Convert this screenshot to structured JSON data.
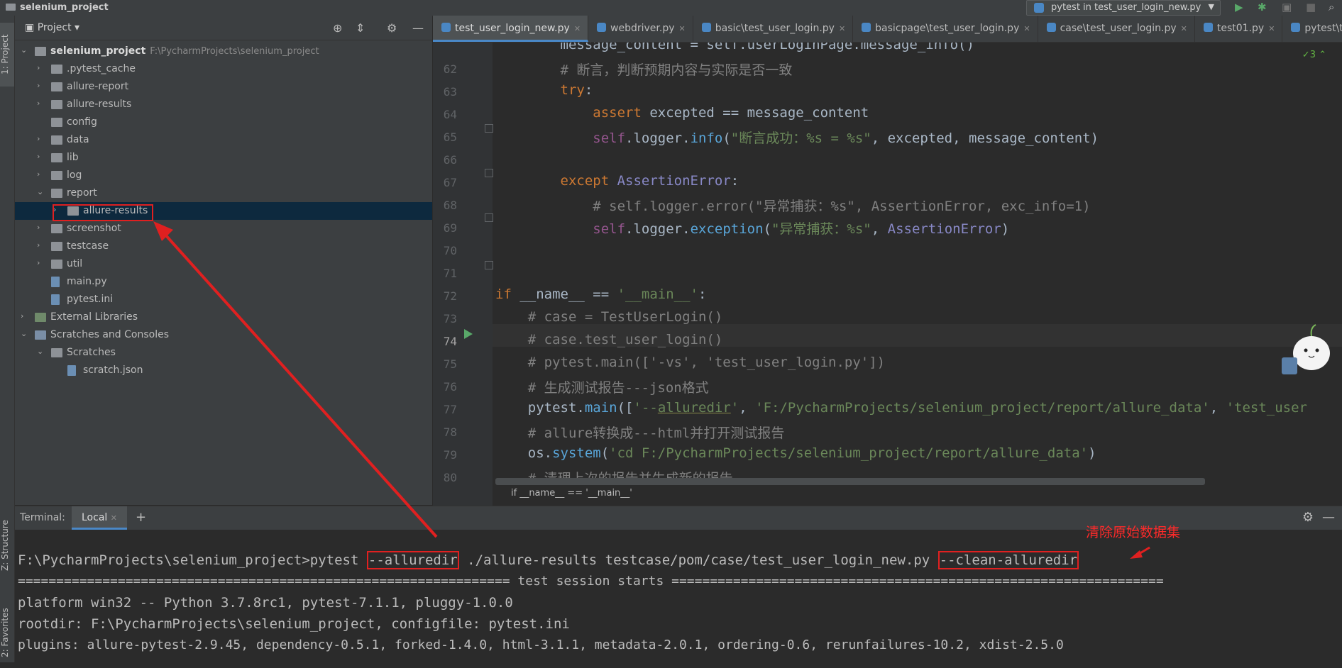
{
  "window": {
    "project_name": "selenium_project",
    "run_config": "pytest in test_user_login_new.py",
    "run_icon": "run-icon",
    "debug_icon": "debug-icon",
    "coverage_icon": "coverage-icon",
    "stop_icon": "stop-icon"
  },
  "side_tabs": {
    "project": "1: Project",
    "structure": "Z: Structure",
    "favorites": "2: Favorites"
  },
  "project_panel": {
    "title": "Project",
    "tree": [
      {
        "label": "selenium_project",
        "path": "F:\\PycharmProjects\\selenium_project",
        "depth": 0,
        "expanded": true,
        "type": "folder",
        "bold": true
      },
      {
        "label": ".pytest_cache",
        "depth": 1,
        "expanded": false,
        "type": "folder"
      },
      {
        "label": "allure-report",
        "depth": 1,
        "expanded": false,
        "type": "folder"
      },
      {
        "label": "allure-results",
        "depth": 1,
        "expanded": false,
        "type": "folder"
      },
      {
        "label": "config",
        "depth": 1,
        "type": "folder",
        "leaf": true
      },
      {
        "label": "data",
        "depth": 1,
        "expanded": false,
        "type": "folder"
      },
      {
        "label": "lib",
        "depth": 1,
        "expanded": false,
        "type": "folder"
      },
      {
        "label": "log",
        "depth": 1,
        "expanded": false,
        "type": "folder"
      },
      {
        "label": "report",
        "depth": 1,
        "expanded": true,
        "type": "folder"
      },
      {
        "label": "allure-results",
        "depth": 2,
        "expanded": false,
        "type": "folder",
        "selected": true
      },
      {
        "label": "screenshot",
        "depth": 1,
        "expanded": false,
        "type": "folder"
      },
      {
        "label": "testcase",
        "depth": 1,
        "expanded": false,
        "type": "folder"
      },
      {
        "label": "util",
        "depth": 1,
        "expanded": false,
        "type": "folder"
      },
      {
        "label": "main.py",
        "depth": 1,
        "type": "file",
        "leaf": true
      },
      {
        "label": "pytest.ini",
        "depth": 1,
        "type": "file",
        "leaf": true
      },
      {
        "label": "External Libraries",
        "depth": 0,
        "expanded": false,
        "type": "library"
      },
      {
        "label": "Scratches and Consoles",
        "depth": 0,
        "expanded": true,
        "type": "scratch"
      },
      {
        "label": "Scratches",
        "depth": 1,
        "expanded": true,
        "type": "folder"
      },
      {
        "label": "scratch.json",
        "depth": 2,
        "type": "file",
        "leaf": true
      }
    ]
  },
  "editor_tabs": [
    {
      "label": "test_user_login_new.py",
      "active": true,
      "closable": true
    },
    {
      "label": "webdriver.py",
      "closable": true
    },
    {
      "label": "basic\\test_user_login.py",
      "closable": true
    },
    {
      "label": "basicpage\\test_user_login.py",
      "closable": true
    },
    {
      "label": "case\\test_user_login.py",
      "closable": true
    },
    {
      "label": "test01.py",
      "closable": true
    },
    {
      "label": "pytest\\test_"
    }
  ],
  "editor": {
    "inspection_count": "3",
    "current_line": "74",
    "breadcrumb": "if __name__ == '__main__'",
    "partial_top_line": "        message_content = self.userLoginPage.message_info()",
    "line_numbers": [
      "62",
      "63",
      "64",
      "65",
      "66",
      "67",
      "68",
      "69",
      "70",
      "71",
      "72",
      "73",
      "74",
      "75",
      "76",
      "77",
      "78",
      "79",
      "80"
    ]
  },
  "terminal": {
    "label": "Terminal:",
    "tab": "Local",
    "lines": {
      "prompt": "F:\\PycharmProjects\\selenium_project>pytest ",
      "opt1": "--alluredir",
      "mid": " ./allure-results testcase/pom/case/test_user_login_new.py ",
      "opt2": "--clean-alluredir",
      "sep": "================================================================ test session starts ================================================================",
      "platform": "platform win32 -- Python 3.7.8rc1, pytest-7.1.1, pluggy-1.0.0",
      "rootdir": "rootdir: F:\\PycharmProjects\\selenium_project, configfile: pytest.ini",
      "plugins": "plugins: allure-pytest-2.9.45, dependency-0.5.1, forked-1.4.0, html-3.1.1, metadata-2.0.1, ordering-0.6, rerunfailures-10.2, xdist-2.5.0"
    }
  },
  "annotation": {
    "text": "清除原始数据集",
    "color": "#ff2a2a"
  }
}
